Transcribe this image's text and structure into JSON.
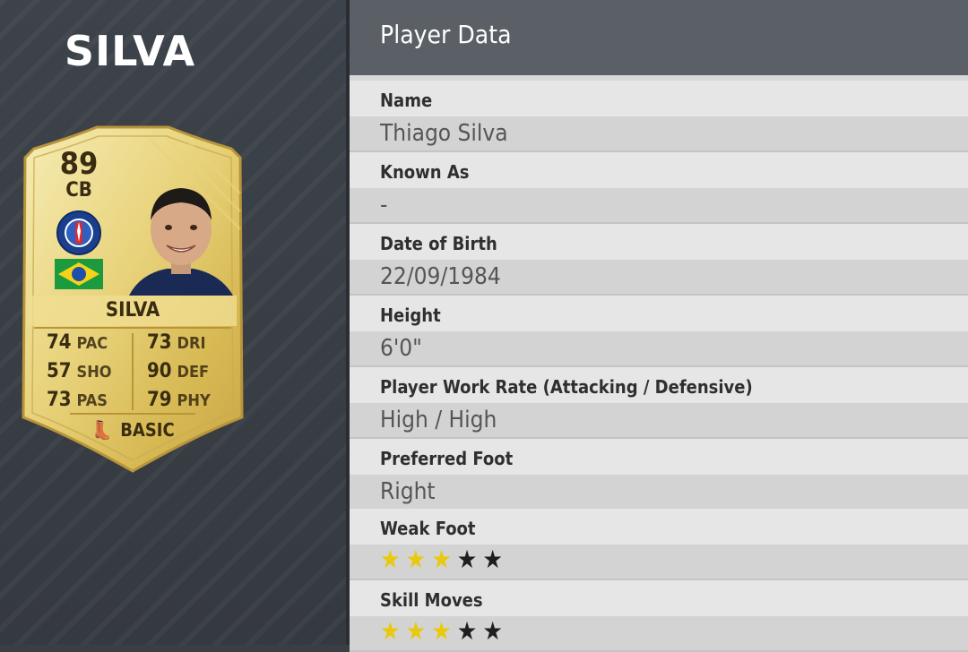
{
  "left_panel": {
    "player_name": "SILVA"
  },
  "card": {
    "rating": "89",
    "position": "CB",
    "name": "SILVA",
    "stats": [
      {
        "value": "74",
        "label": "PAC"
      },
      {
        "value": "73",
        "label": "DRI"
      },
      {
        "value": "57",
        "label": "SHO"
      },
      {
        "value": "90",
        "label": "DEF"
      },
      {
        "value": "73",
        "label": "PAS"
      },
      {
        "value": "79",
        "label": "PHY"
      }
    ],
    "chemistry_style": "BASIC",
    "chemistry_icon": "boot-icon",
    "club_badge": "psg-badge-icon",
    "nation_flag": "brazil-flag-icon",
    "colors": {
      "gold_light": "#f3e6a4",
      "gold_dark": "#c9a745",
      "text": "#3a2c10"
    }
  },
  "player_data": {
    "title": "Player Data",
    "fields": [
      {
        "label": "Name",
        "value": "Thiago Silva"
      },
      {
        "label": "Known As",
        "value": "-"
      },
      {
        "label": "Date of Birth",
        "value": "22/09/1984"
      },
      {
        "label": "Height",
        "value": "6'0\""
      },
      {
        "label": "Player Work Rate (Attacking / Defensive)",
        "value": "High / High"
      },
      {
        "label": "Preferred Foot",
        "value": "Right"
      }
    ],
    "weak_foot": {
      "label": "Weak Foot",
      "stars": 3,
      "max": 5
    },
    "skill_moves": {
      "label": "Skill Moves",
      "stars": 3,
      "max": 5
    }
  },
  "colors": {
    "star_on": "#e9c90c",
    "star_off": "#1f1f1f",
    "header_bg": "#5b5f66"
  }
}
